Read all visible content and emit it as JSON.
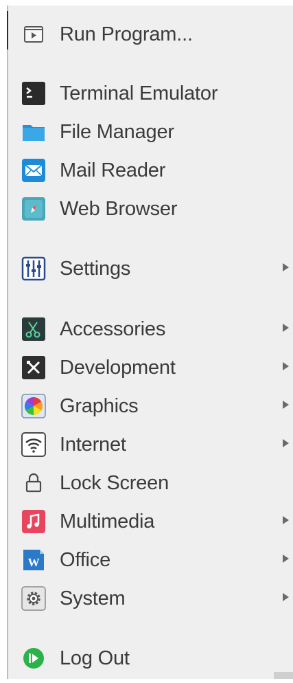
{
  "menu": {
    "run_program": {
      "label": "Run Program...",
      "icon": "run-program-icon"
    },
    "favorites": [
      {
        "label": "Terminal Emulator",
        "icon": "terminal-icon"
      },
      {
        "label": "File Manager",
        "icon": "folder-icon"
      },
      {
        "label": "Mail Reader",
        "icon": "mail-icon"
      },
      {
        "label": "Web Browser",
        "icon": "web-browser-icon"
      }
    ],
    "settings": {
      "label": "Settings",
      "icon": "settings-icon"
    },
    "categories": [
      {
        "label": "Accessories",
        "icon": "accessories-icon"
      },
      {
        "label": "Development",
        "icon": "development-icon"
      },
      {
        "label": "Graphics",
        "icon": "graphics-icon"
      },
      {
        "label": "Internet",
        "icon": "internet-icon"
      },
      {
        "label": "Lock Screen",
        "icon": "lock-icon"
      },
      {
        "label": "Multimedia",
        "icon": "multimedia-icon"
      },
      {
        "label": "Office",
        "icon": "office-icon"
      },
      {
        "label": "System",
        "icon": "system-icon"
      }
    ],
    "log_out": {
      "label": "Log Out",
      "icon": "log-out-icon"
    }
  },
  "colors": {
    "menu_background": "#efefef",
    "text": "#3b3b3b",
    "submenu_arrow": "#6a6a6a",
    "terminal": "#2b2b2b",
    "folder": "#3aa0dc",
    "mail": "#1d8bd8",
    "browser": "#4aa6b7",
    "multimedia": "#e8455f",
    "office": "#2b79c8",
    "log_out": "#2bb34a"
  }
}
